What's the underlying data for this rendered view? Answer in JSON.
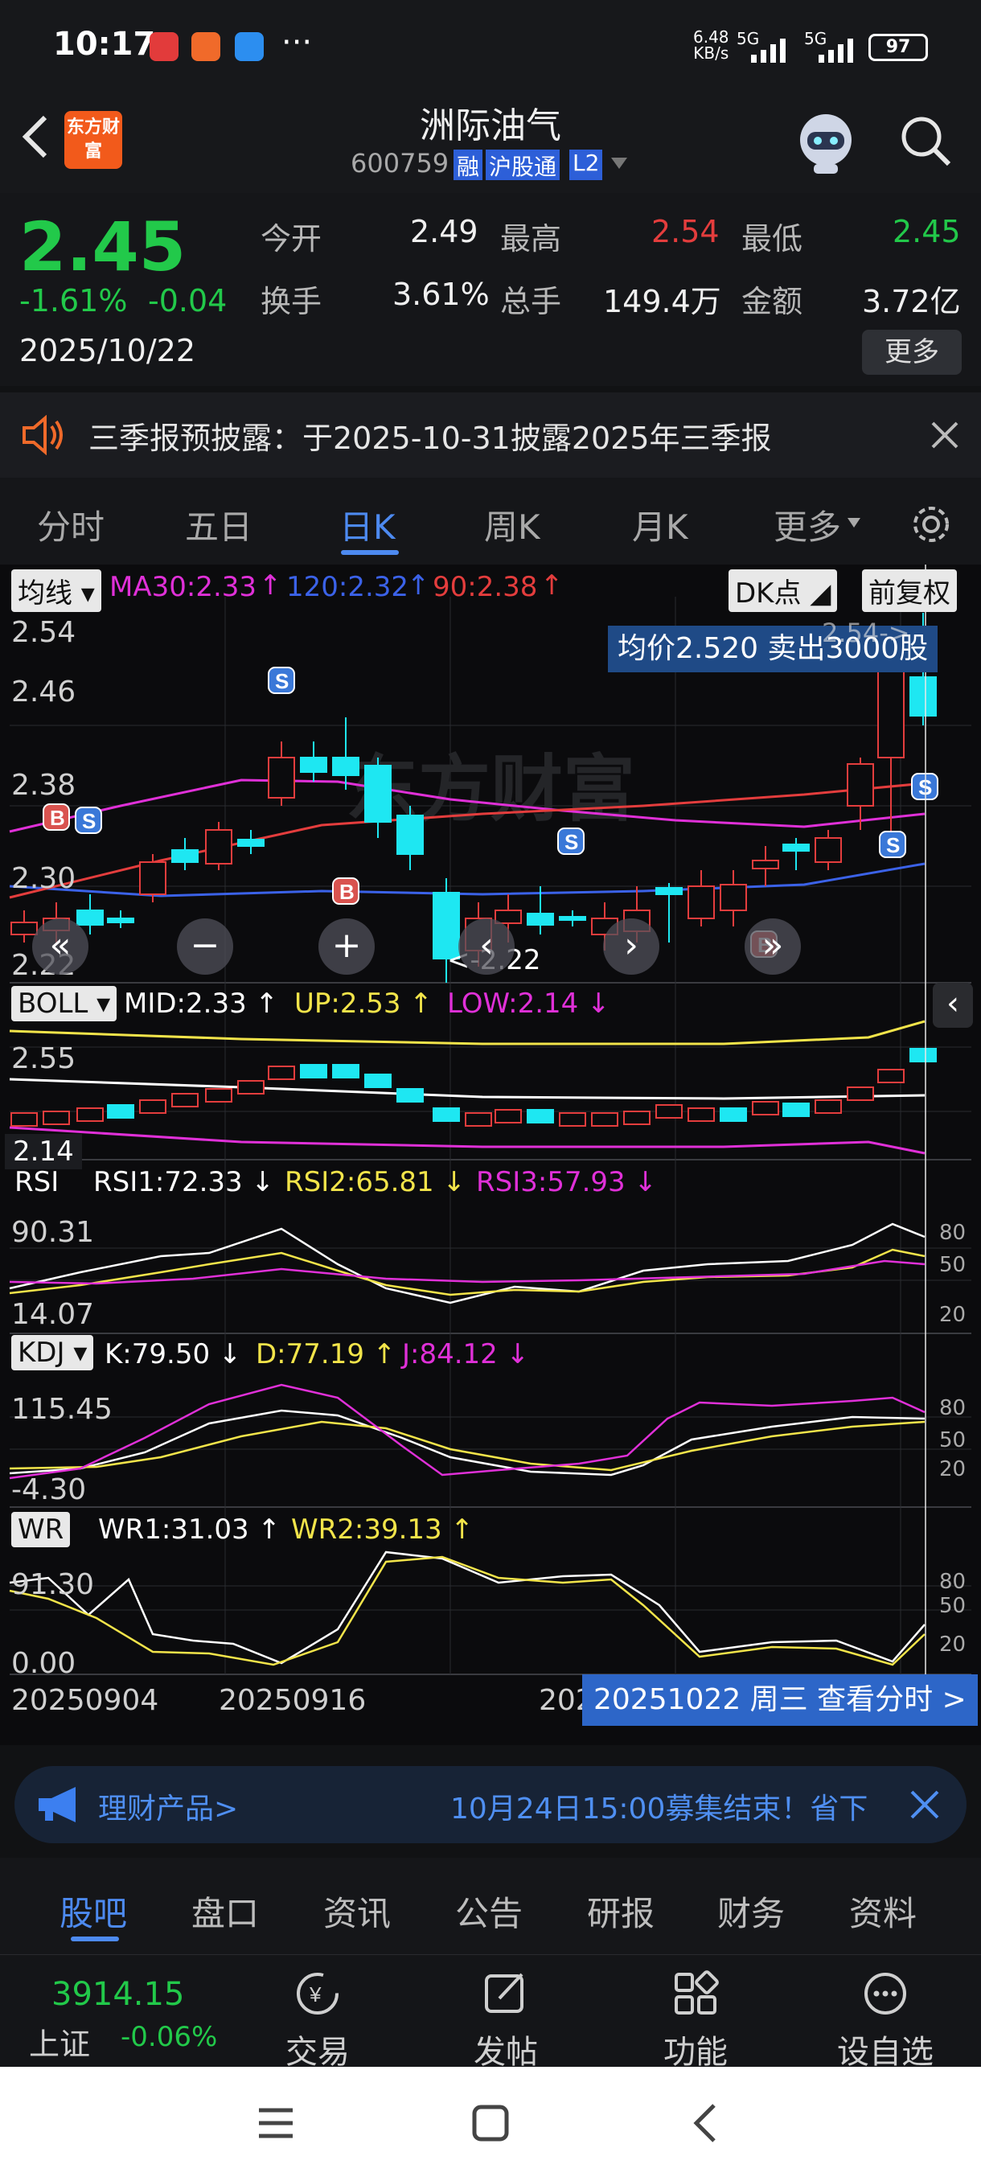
{
  "status": {
    "time": "10:17",
    "speed": "6.48",
    "speed_unit": "KB/s",
    "net1": "5G",
    "net2": "5G",
    "battery": "97"
  },
  "header": {
    "logo": "东方财富",
    "title": "洲际油气",
    "code": "600759",
    "badges": [
      "融",
      "沪股通",
      "L2"
    ]
  },
  "quote": {
    "price": "2.45",
    "change_pct": "-1.61%",
    "change": "-0.04",
    "date": "2025/10/22",
    "open_label": "今开",
    "open": "2.49",
    "high_label": "最高",
    "high": "2.54",
    "low_label": "最低",
    "low": "2.45",
    "turnover_label": "换手",
    "turnover": "3.61%",
    "volume_label": "总手",
    "volume": "149.4万",
    "amount_label": "金额",
    "amount": "3.72亿",
    "more": "更多"
  },
  "notice": {
    "text": "三季报预披露：于2025-10-31披露2025年三季报"
  },
  "tabs": [
    {
      "label": "分时"
    },
    {
      "label": "五日"
    },
    {
      "label": "日K",
      "active": true
    },
    {
      "label": "周K"
    },
    {
      "label": "月K"
    },
    {
      "label": "更多"
    }
  ],
  "main_chart": {
    "type_label": "均线",
    "ma30": "MA30:2.33",
    "ma120": "120:2.32",
    "ma90": "90:2.38",
    "dk_label": "DK点",
    "adjust_label": "前复权",
    "y_labels": [
      "2.54",
      "2.46",
      "2.38",
      "2.30",
      "2.22"
    ],
    "tooltip": "均价2.520  卖出3000股",
    "high_marker": "2.54->",
    "low_marker": "<-2.22",
    "watermark": "东方财富"
  },
  "boll": {
    "label": "BOLL",
    "mid": "MID:2.33",
    "up": "UP:2.53",
    "low": "LOW:2.14",
    "y_top": "2.55",
    "y_bottom": "2.14"
  },
  "rsi": {
    "label": "RSI",
    "rsi1": "RSI1:72.33",
    "rsi2": "RSI2:65.81",
    "rsi3": "RSI3:57.93",
    "y_top": "90.31",
    "y_bottom": "14.07",
    "right": [
      "80",
      "50",
      "20"
    ]
  },
  "kdj": {
    "label": "KDJ",
    "k": "K:79.50",
    "d": "D:77.19",
    "j": "J:84.12",
    "y_top": "115.45",
    "y_bottom": "-4.30",
    "right": [
      "80",
      "50",
      "20"
    ]
  },
  "wr": {
    "label": "WR",
    "wr1": "WR1:31.03",
    "wr2": "WR2:39.13",
    "y_top": "91.30",
    "y_bottom": "0.00",
    "right": [
      "80",
      "50",
      "20"
    ]
  },
  "x_axis": {
    "dates": [
      "20250904",
      "20250916",
      "202"
    ],
    "link": "20251022 周三 查看分时 >"
  },
  "banner": {
    "left": "理财产品>",
    "right": "10月24日15:00募集结束！省下"
  },
  "bottom_tabs": [
    {
      "label": "股吧",
      "active": true
    },
    {
      "label": "盘口"
    },
    {
      "label": "资讯"
    },
    {
      "label": "公告"
    },
    {
      "label": "研报"
    },
    {
      "label": "财务"
    },
    {
      "label": "资料"
    }
  ],
  "dock": {
    "index_value": "3914.15",
    "index_name": "上证",
    "index_change": "-0.06%",
    "items": [
      "交易",
      "发帖",
      "功能",
      "设自选"
    ]
  },
  "colors": {
    "up": "#e43d3d",
    "down": "#22c94a",
    "cyan": "#1ee7f2",
    "magenta": "#e030d8",
    "yellow": "#f2e44a",
    "blue": "#3b62e8"
  }
}
